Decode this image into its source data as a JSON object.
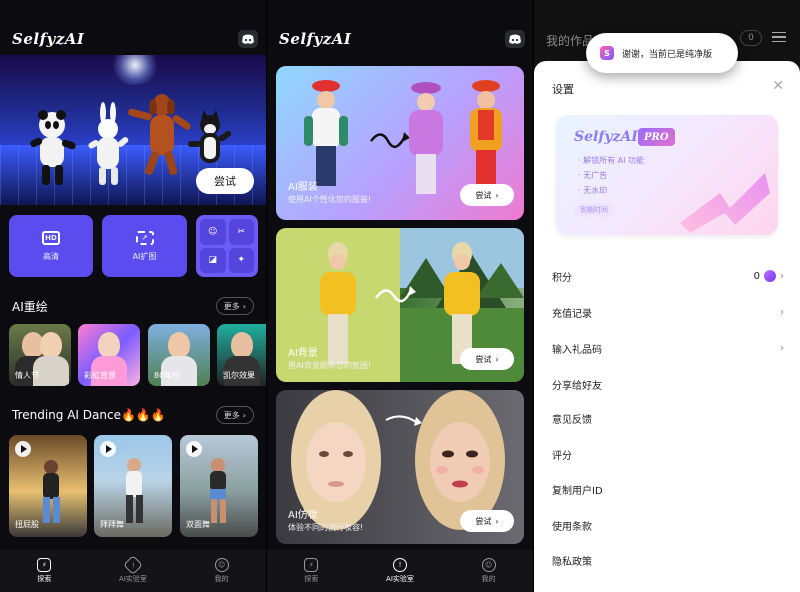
{
  "app": {
    "logo": "SelfyzAI"
  },
  "panel1": {
    "hero_button": "尝试",
    "tools": [
      "高清",
      "AI扩图"
    ],
    "tool_icons": [
      "HD"
    ],
    "section1": {
      "title": "AI重绘",
      "more": "更多"
    },
    "ai_redraw": [
      "情人节",
      "彩虹背景",
      "80年代",
      "凯尔效果"
    ],
    "section2": {
      "title": "Trending AI Dance🔥🔥🔥",
      "more": "更多"
    },
    "dances": [
      "扭屁股",
      "拜拜舞",
      "双面舞"
    ],
    "tabs": [
      "探索",
      "AI实验室",
      "我的"
    ],
    "active_tab": 0
  },
  "panel2": {
    "cards": [
      {
        "title": "AI服装",
        "subtitle": "使用AI个性化您的服装!",
        "button": "尝试"
      },
      {
        "title": "AI背景",
        "subtitle": "用AI背景刷新您的氛围!",
        "button": "尝试"
      },
      {
        "title": "AI仿妆",
        "subtitle": "体验不同的流行妆容!",
        "button": "尝试"
      }
    ],
    "tabs": [
      "探索",
      "AI实验室",
      "我的"
    ],
    "active_tab": 1
  },
  "panel3": {
    "header_title": "我的作品",
    "header_count": "0",
    "toast": "谢谢，当前已是纯净版",
    "sheet_title": "设置",
    "pro": {
      "logo": "SelfyzAI",
      "badge": "PRO",
      "features": [
        "· 解锁所有 AI 功能",
        "· 无广告",
        "· 无水印"
      ],
      "expire_label": "到期时间"
    },
    "settings": [
      {
        "label": "积分",
        "value": "0",
        "coin": true,
        "chevron": true
      },
      {
        "label": "充值记录",
        "chevron": true
      },
      {
        "label": "输入礼品码",
        "chevron": true
      },
      {
        "label": "分享给好友"
      },
      {
        "label": "意见反馈"
      },
      {
        "label": "评分"
      },
      {
        "label": "复制用户ID"
      },
      {
        "label": "使用条款"
      },
      {
        "label": "隐私政策"
      }
    ]
  },
  "colors": {
    "accent": "#5b4cf0",
    "pro_purple": "#9a7ce6",
    "background": "#0b0b10"
  }
}
